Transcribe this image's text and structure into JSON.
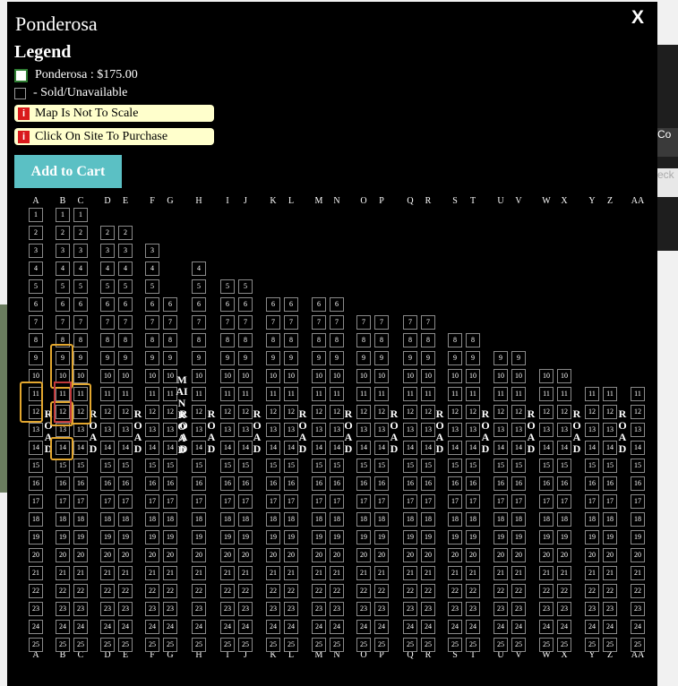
{
  "background": {
    "buttons": [
      "Co",
      "eck"
    ]
  },
  "modal": {
    "title": "Ponderosa",
    "close_label": "X",
    "legend": {
      "heading": "Legend",
      "items": [
        {
          "label": "Ponderosa : $175.00",
          "color": "#ffffff"
        },
        {
          "label": " - Sold/Unavailable",
          "color": "#000000"
        }
      ]
    },
    "notes": [
      {
        "icon": "i",
        "text": "Map Is Not To Scale"
      },
      {
        "icon": "i",
        "text": "Click On Site To Purchase"
      }
    ],
    "add_to_cart_label": "Add to Cart"
  },
  "site_map": {
    "road_label": "ROAD",
    "main_road_label": "MAIN ROAD",
    "columns": [
      {
        "label": "A",
        "start": 1
      },
      {
        "label": "B",
        "start": 1
      },
      {
        "label": "C",
        "start": 1
      },
      {
        "label": "D",
        "start": 2
      },
      {
        "label": "E",
        "start": 2
      },
      {
        "label": "F",
        "start": 3
      },
      {
        "label": "G",
        "start": 6
      },
      {
        "label": "H",
        "start": 4
      },
      {
        "label": "I",
        "start": 5
      },
      {
        "label": "J",
        "start": 5
      },
      {
        "label": "K",
        "start": 6
      },
      {
        "label": "L",
        "start": 6
      },
      {
        "label": "M",
        "start": 6
      },
      {
        "label": "N",
        "start": 6
      },
      {
        "label": "O",
        "start": 7
      },
      {
        "label": "P",
        "start": 7
      },
      {
        "label": "Q",
        "start": 7
      },
      {
        "label": "R",
        "start": 7
      },
      {
        "label": "S",
        "start": 8
      },
      {
        "label": "T",
        "start": 8
      },
      {
        "label": "U",
        "start": 9
      },
      {
        "label": "V",
        "start": 9
      },
      {
        "label": "W",
        "start": 10
      },
      {
        "label": "X",
        "start": 10
      },
      {
        "label": "Y",
        "start": 11
      },
      {
        "label": "Z",
        "start": 11
      },
      {
        "label": "AA",
        "start": 11
      }
    ],
    "max_site": 25
  }
}
